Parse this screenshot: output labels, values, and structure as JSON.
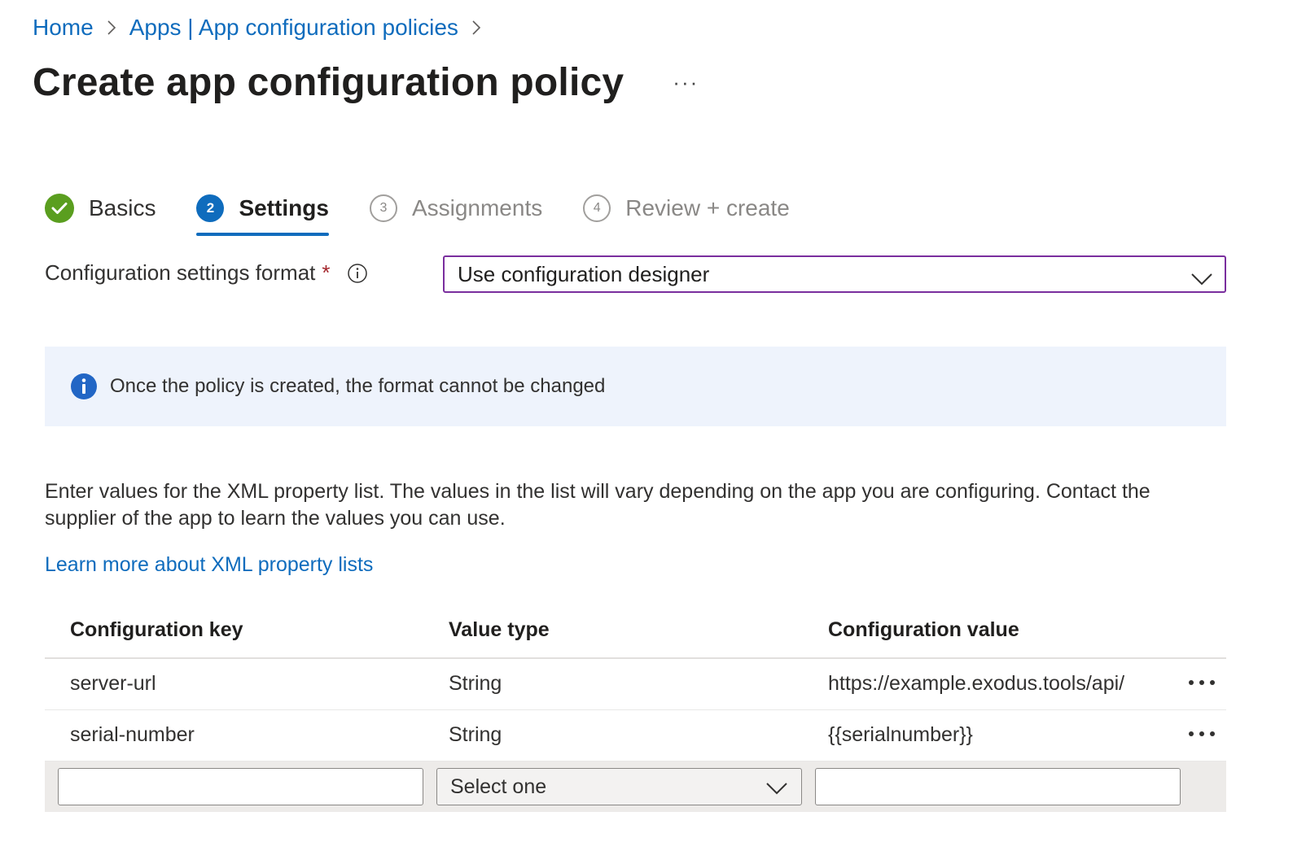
{
  "breadcrumb": {
    "home": "Home",
    "apps": "Apps | App configuration policies"
  },
  "page": {
    "title": "Create app configuration policy",
    "more": "···"
  },
  "wizard": {
    "steps": [
      {
        "number": "",
        "label": "Basics",
        "state": "completed"
      },
      {
        "number": "2",
        "label": "Settings",
        "state": "current"
      },
      {
        "number": "3",
        "label": "Assignments",
        "state": "upcoming"
      },
      {
        "number": "4",
        "label": "Review + create",
        "state": "upcoming"
      }
    ]
  },
  "format": {
    "label": "Configuration settings format",
    "required_marker": "*",
    "selected": "Use configuration designer"
  },
  "info_bar": {
    "text": "Once the policy is created, the format cannot be changed"
  },
  "description": "Enter values for the XML property list. The values in the list will vary depending on the app you are configuring. Contact the supplier of the app to learn the values you can use.",
  "learn_more": "Learn more about XML property lists",
  "table": {
    "headers": [
      "Configuration key",
      "Value type",
      "Configuration value"
    ],
    "rows": [
      {
        "key": "server-url",
        "type": "String",
        "value": "https://example.exodus.tools/api/"
      },
      {
        "key": "serial-number",
        "type": "String",
        "value": "{{serialnumber}}"
      }
    ],
    "new_row": {
      "key_value": "",
      "type_placeholder": "Select one",
      "value_value": ""
    }
  },
  "colors": {
    "link": "#0f6cbd",
    "accent": "#0f6cbd",
    "success": "#5a9e1f",
    "required": "#a4262c",
    "focus_border": "#7a2e9e",
    "info_background": "#eef3fc"
  }
}
